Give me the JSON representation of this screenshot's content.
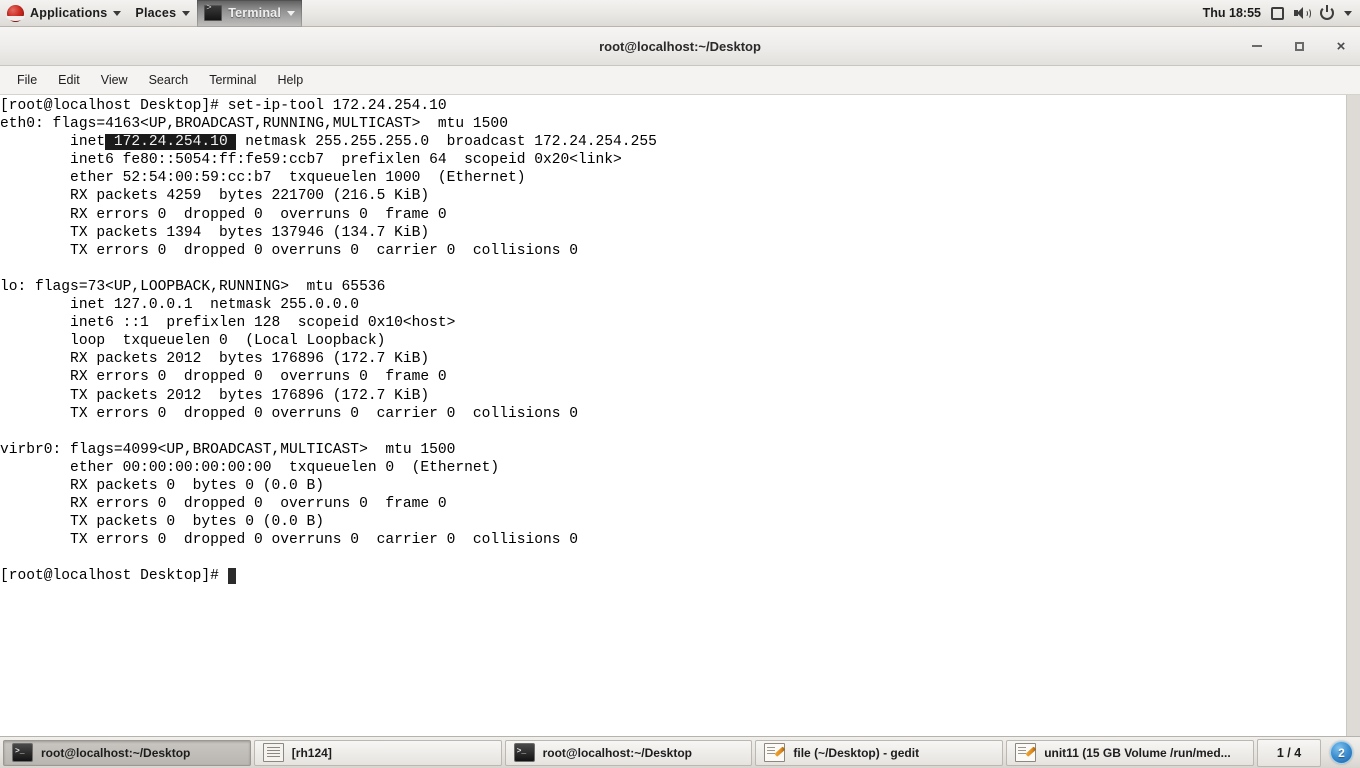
{
  "top_panel": {
    "applications_label": "Applications",
    "places_label": "Places",
    "active_app_label": "Terminal",
    "clock": "Thu 18:55",
    "icons": {
      "logo": "redhat-logo-icon",
      "display": "display-icon",
      "volume": "volume-icon",
      "power": "power-icon"
    }
  },
  "window": {
    "title": "root@localhost:~/Desktop",
    "buttons": {
      "minimize": "–",
      "maximize": "□",
      "close": "×"
    },
    "menubar": [
      "File",
      "Edit",
      "View",
      "Search",
      "Terminal",
      "Help"
    ]
  },
  "terminal": {
    "prompt": "[root@localhost Desktop]# ",
    "command": "set-ip-tool 172.24.254.10",
    "highlight_text": " 172.24.254.10 ",
    "lines": [
      {
        "id": "l0",
        "segments": [
          {
            "t": "[root@localhost Desktop]# set-ip-tool 172.24.254.10",
            "s": "normal"
          }
        ]
      },
      {
        "id": "l1",
        "segments": [
          {
            "t": "eth0: flags=4163<UP,BROADCAST,RUNNING,MULTICAST>  mtu 1500",
            "s": "normal"
          }
        ]
      },
      {
        "id": "l2",
        "segments": [
          {
            "t": "        inet",
            "s": "normal"
          },
          {
            "t": " 172.24.254.10 ",
            "s": "highlight"
          },
          {
            "t": " netmask 255.255.255.0  broadcast 172.24.254.255",
            "s": "normal"
          }
        ]
      },
      {
        "id": "l3",
        "segments": [
          {
            "t": "        inet6 fe80::5054:ff:fe59:ccb7  prefixlen 64  scopeid 0x20<link>",
            "s": "normal"
          }
        ]
      },
      {
        "id": "l4",
        "segments": [
          {
            "t": "        ether 52:54:00:59:cc:b7  txqueuelen 1000  (Ethernet)",
            "s": "normal"
          }
        ]
      },
      {
        "id": "l5",
        "segments": [
          {
            "t": "        RX packets 4259  bytes 221700 (216.5 KiB)",
            "s": "normal"
          }
        ]
      },
      {
        "id": "l6",
        "segments": [
          {
            "t": "        RX errors 0  dropped 0  overruns 0  frame 0",
            "s": "normal"
          }
        ]
      },
      {
        "id": "l7",
        "segments": [
          {
            "t": "        TX packets 1394  bytes 137946 (134.7 KiB)",
            "s": "normal"
          }
        ]
      },
      {
        "id": "l8",
        "segments": [
          {
            "t": "        TX errors 0  dropped 0 overruns 0  carrier 0  collisions 0",
            "s": "normal"
          }
        ]
      },
      {
        "id": "l9",
        "segments": [
          {
            "t": "",
            "s": "normal"
          }
        ]
      },
      {
        "id": "l10",
        "segments": [
          {
            "t": "lo: flags=73<UP,LOOPBACK,RUNNING>  mtu 65536",
            "s": "normal"
          }
        ]
      },
      {
        "id": "l11",
        "segments": [
          {
            "t": "        inet 127.0.0.1  netmask 255.0.0.0",
            "s": "normal"
          }
        ]
      },
      {
        "id": "l12",
        "segments": [
          {
            "t": "        inet6 ::1  prefixlen 128  scopeid 0x10<host>",
            "s": "normal"
          }
        ]
      },
      {
        "id": "l13",
        "segments": [
          {
            "t": "        loop  txqueuelen 0  (Local Loopback)",
            "s": "normal"
          }
        ]
      },
      {
        "id": "l14",
        "segments": [
          {
            "t": "        RX packets 2012  bytes 176896 (172.7 KiB)",
            "s": "normal"
          }
        ]
      },
      {
        "id": "l15",
        "segments": [
          {
            "t": "        RX errors 0  dropped 0  overruns 0  frame 0",
            "s": "normal"
          }
        ]
      },
      {
        "id": "l16",
        "segments": [
          {
            "t": "        TX packets 2012  bytes 176896 (172.7 KiB)",
            "s": "normal"
          }
        ]
      },
      {
        "id": "l17",
        "segments": [
          {
            "t": "        TX errors 0  dropped 0 overruns 0  carrier 0  collisions 0",
            "s": "normal"
          }
        ]
      },
      {
        "id": "l18",
        "segments": [
          {
            "t": "",
            "s": "normal"
          }
        ]
      },
      {
        "id": "l19",
        "segments": [
          {
            "t": "virbr0: flags=4099<UP,BROADCAST,MULTICAST>  mtu 1500",
            "s": "normal"
          }
        ]
      },
      {
        "id": "l20",
        "segments": [
          {
            "t": "        ether 00:00:00:00:00:00  txqueuelen 0  (Ethernet)",
            "s": "normal"
          }
        ]
      },
      {
        "id": "l21",
        "segments": [
          {
            "t": "        RX packets 0  bytes 0 (0.0 B)",
            "s": "normal"
          }
        ]
      },
      {
        "id": "l22",
        "segments": [
          {
            "t": "        RX errors 0  dropped 0  overruns 0  frame 0",
            "s": "normal"
          }
        ]
      },
      {
        "id": "l23",
        "segments": [
          {
            "t": "        TX packets 0  bytes 0 (0.0 B)",
            "s": "normal"
          }
        ]
      },
      {
        "id": "l24",
        "segments": [
          {
            "t": "        TX errors 0  dropped 0 overruns 0  carrier 0  collisions 0",
            "s": "normal"
          }
        ]
      },
      {
        "id": "l25",
        "segments": [
          {
            "t": "",
            "s": "normal"
          }
        ]
      },
      {
        "id": "l26",
        "segments": [
          {
            "t": "[root@localhost Desktop]# ",
            "s": "normal"
          },
          {
            "t": " ",
            "s": "cursor"
          }
        ]
      }
    ]
  },
  "taskbar": {
    "tasks": [
      {
        "label": "root@localhost:~/Desktop",
        "icon": "terminal-icon",
        "active": true
      },
      {
        "label": "[rh124]",
        "icon": "document-icon",
        "active": false
      },
      {
        "label": "root@localhost:~/Desktop",
        "icon": "terminal-icon",
        "active": false
      },
      {
        "label": "file (~/Desktop) - gedit",
        "icon": "gedit-icon",
        "active": false
      },
      {
        "label": "unit11 (15 GB Volume /run/med...",
        "icon": "gedit-icon",
        "active": false
      }
    ],
    "workspace": "1 / 4",
    "notification_count": "2"
  },
  "colors": {
    "panel_bg": "#ebe9e6",
    "terminal_bg": "#ffffff",
    "terminal_fg": "#000000",
    "highlight_bg": "#1a1a1a",
    "highlight_fg": "#f2f2f2",
    "badge_blue": "#3e8fd0",
    "logo_red": "#cc2a20"
  }
}
